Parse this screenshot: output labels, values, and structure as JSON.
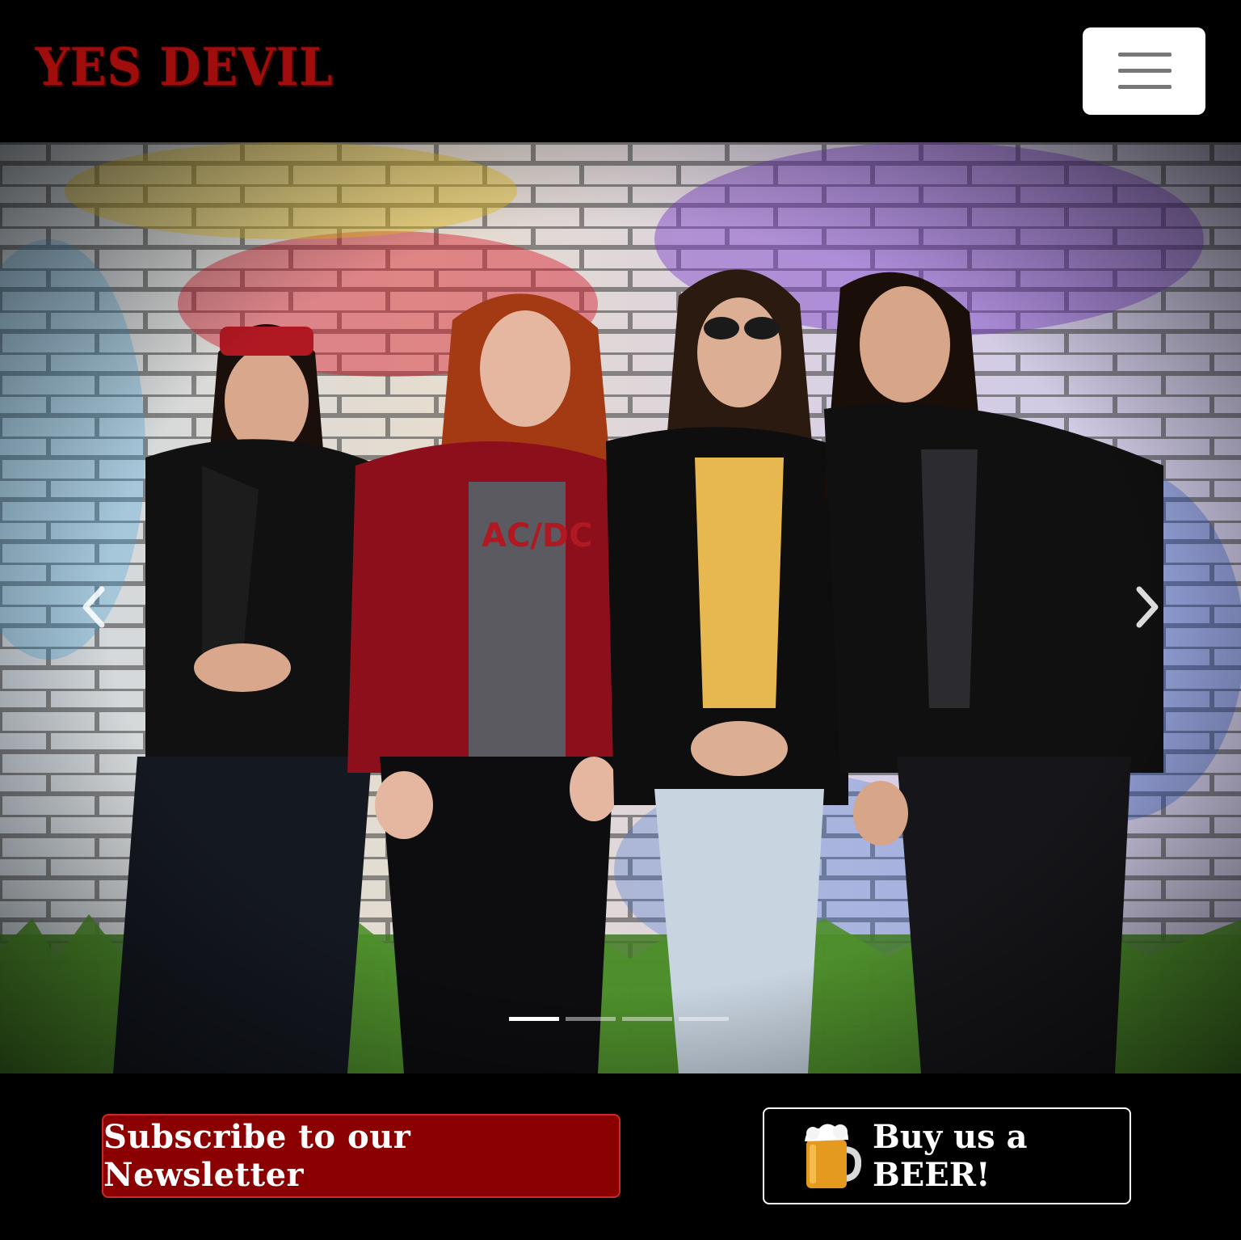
{
  "header": {
    "brand": "YES DEVIL",
    "menu_icon": "hamburger-menu-icon"
  },
  "carousel": {
    "prev_icon": "chevron-left-icon",
    "next_icon": "chevron-right-icon",
    "slide_count": 4,
    "active_slide": 1
  },
  "actions": {
    "newsletter_label": "Subscribe to our Newsletter",
    "beer_label": "Buy us a BEER!",
    "beer_icon": "beer-mug-icon"
  },
  "colors": {
    "page_background": "#000000",
    "brand_red": "#a00d0d",
    "newsletter_button": "#8b0000",
    "newsletter_border": "#c92a2a"
  }
}
